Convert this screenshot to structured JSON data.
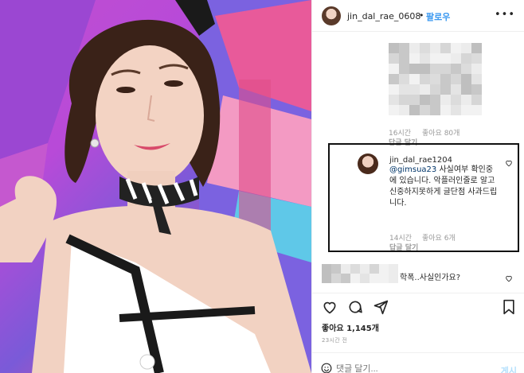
{
  "header": {
    "username": "jin_dal_rae_0608",
    "separator": "•",
    "follow_label": "팔로우",
    "more_label": "•••"
  },
  "comment1": {
    "meta_time": "16시간",
    "meta_likes": "좋아요 80개",
    "reply_label": "답글 달기"
  },
  "comment2": {
    "username": "jin_dal_rae1204",
    "mention": "@gimsua23",
    "text": " 사실여부 확인중에 있습니다. 악플러인줄로 알고 신중하지못하게 글단점 사과드립니다.",
    "meta_time": "14시간",
    "meta_likes": "좋아요 6개",
    "reply_label": "답글 달기"
  },
  "comment3": {
    "text": "학폭..사실인가요?"
  },
  "post": {
    "likes": "좋아요 1,145개",
    "time": "23시간 전"
  },
  "composer": {
    "placeholder": "댓글 달기...",
    "post_label": "게시"
  },
  "colors": {
    "link_blue": "#3897f0",
    "mention_blue": "#003569",
    "meta_grey": "#999999",
    "border": "#efefef"
  },
  "icons": [
    "heart-icon",
    "comment-icon",
    "share-icon",
    "bookmark-icon",
    "emoji-icon",
    "more-icon"
  ]
}
